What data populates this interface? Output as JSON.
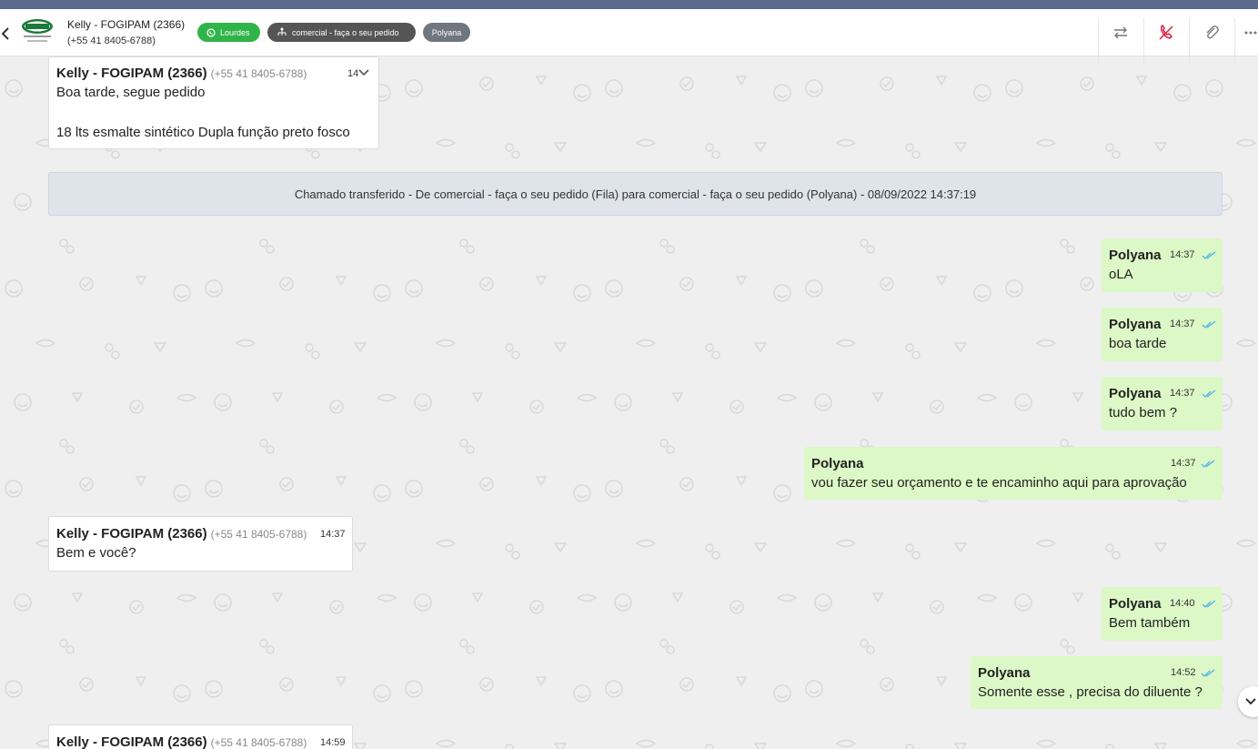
{
  "header": {
    "contact_name": "Kelly - FOGIPAM (2366)",
    "contact_phone": "(+55 41 8405-6788)",
    "badges": {
      "channel": "Lourdes",
      "queue": "comercial - faça o seu pedido",
      "agent": "Polyana"
    },
    "logo_text": "FOGIPAM",
    "colors": {
      "green_badge": "#2fb44a",
      "dark_badge": "#555555",
      "gray_badge": "#707680",
      "hangup_icon": "#d81b3c"
    }
  },
  "messages": {
    "m1": {
      "sender": "Kelly - FOGIPAM (2366)",
      "phone": "(+55 41 8405-6788)",
      "time": "14",
      "line1": "Boa tarde, segue pedido",
      "line2": "18 lts esmalte sintético Dupla função preto fosco"
    },
    "system": "Chamado transferido - De comercial - faça o seu pedido (Fila) para comercial - faça o seu pedido (Polyana) - 08/09/2022 14:37:19",
    "m2": {
      "sender": "Polyana",
      "time": "14:37",
      "text": "oLA"
    },
    "m3": {
      "sender": "Polyana",
      "time": "14:37",
      "text": "boa tarde"
    },
    "m4": {
      "sender": "Polyana",
      "time": "14:37",
      "text": "tudo bem ?"
    },
    "m5": {
      "sender": "Polyana",
      "time": "14:37",
      "text": "vou fazer seu orçamento e te encaminho aqui para aprovação"
    },
    "m6": {
      "sender": "Kelly - FOGIPAM (2366)",
      "phone": "(+55 41 8405-6788)",
      "time": "14:37",
      "text": "Bem e você?"
    },
    "m7": {
      "sender": "Polyana",
      "time": "14:40",
      "text": "Bem também"
    },
    "m8": {
      "sender": "Polyana",
      "time": "14:52",
      "text": "Somente esse , precisa do diluente ?"
    },
    "m9": {
      "sender": "Kelly - FOGIPAM (2366)",
      "phone": "(+55 41 8405-6788)",
      "time": "14:59"
    }
  }
}
